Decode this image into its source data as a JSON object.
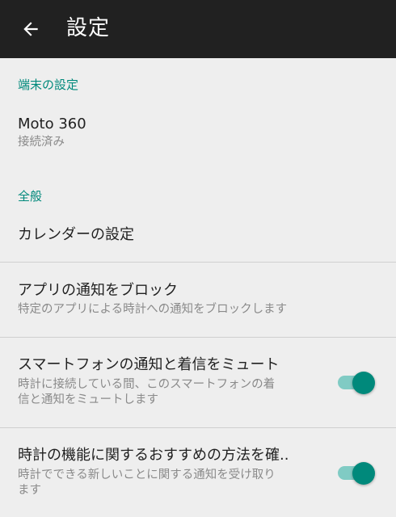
{
  "app_bar": {
    "title": "設定",
    "back_icon": "arrow-back-icon"
  },
  "sections": {
    "device": {
      "header": "端末の設定",
      "device_item": {
        "title": "Moto 360",
        "summary": "接続済み"
      }
    },
    "general": {
      "header": "全般",
      "calendar": {
        "title": "カレンダーの設定"
      },
      "block_app": {
        "title": "アプリの通知をブロック",
        "summary": "特定のアプリによる時計への通知をブロックします"
      },
      "mute_phone": {
        "title": "スマートフォンの通知と着信をミュート",
        "summary_line1": "時計に接続している間、このスマートフォンの着",
        "summary_line2": "信と通知をミュートします",
        "enabled": true
      },
      "tips": {
        "title": "時計の機能に関するおすすめの方法を確..",
        "summary_line1": "時計でできる新しいことに関する通知を受け取り",
        "summary_line2": "ます",
        "enabled": true
      }
    }
  },
  "colors": {
    "app_bar": "#212121",
    "accent": "#00897b",
    "switch_track": "#80cbc4",
    "background": "#eeeeee"
  }
}
